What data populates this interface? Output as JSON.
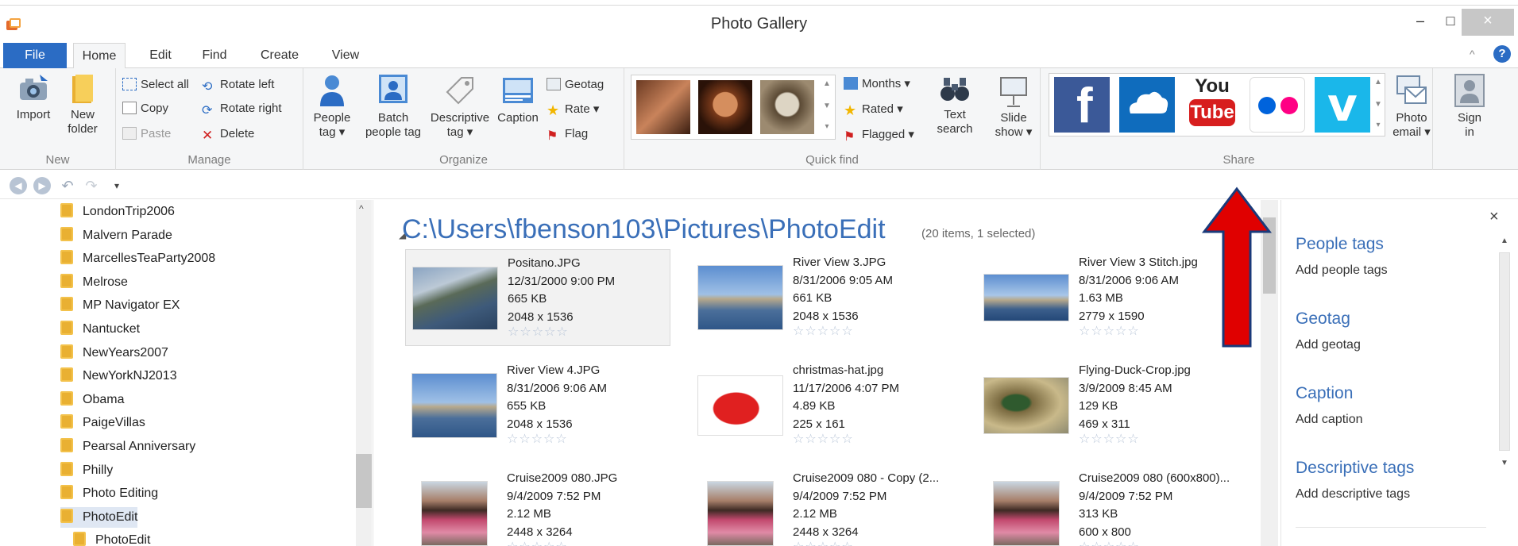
{
  "window": {
    "title": "Photo Gallery",
    "minimize": "–",
    "maximize": "□",
    "close": "×"
  },
  "tabs": [
    "File",
    "Home",
    "Edit",
    "Find",
    "Create",
    "View"
  ],
  "ribbon_controls": {
    "collapse": "^",
    "help": "?"
  },
  "ribbon": {
    "new": {
      "label": "New",
      "import": "Import",
      "new_folder_1": "New",
      "new_folder_2": "folder"
    },
    "manage": {
      "label": "Manage",
      "select_all": "Select all",
      "copy": "Copy",
      "paste": "Paste",
      "rotate_left": "Rotate left",
      "rotate_right": "Rotate right",
      "delete": "Delete"
    },
    "organize": {
      "label": "Organize",
      "people_tag_1": "People",
      "people_tag_2": "tag ▾",
      "batch_1": "Batch",
      "batch_2": "people tag",
      "desc_1": "Descriptive",
      "desc_2": "tag ▾",
      "caption": "Caption",
      "geotag": "Geotag",
      "rate": "Rate ▾",
      "flag": "Flag"
    },
    "quickfind": {
      "label": "Quick find",
      "months": "Months ▾",
      "rated": "Rated ▾",
      "flagged": "Flagged ▾",
      "text_1": "Text",
      "text_2": "search"
    },
    "slideshow": {
      "line1": "Slide",
      "line2": "show ▾"
    },
    "share": {
      "label": "Share",
      "services": [
        "facebook",
        "onedrive",
        "youtube",
        "flickr",
        "vimeo"
      ],
      "youtube_1": "You",
      "youtube_2": "Tube",
      "photo_email_1": "Photo",
      "photo_email_2": "email ▾"
    },
    "signin": {
      "line1": "Sign",
      "line2": "in"
    }
  },
  "tree": {
    "items": [
      "LondonTrip2006",
      "Malvern Parade",
      "MarcellesTeaParty2008",
      "Melrose",
      "MP Navigator EX",
      "Nantucket",
      "NewYears2007",
      "NewYorkNJ2013",
      "Obama",
      "PaigeVillas",
      "Pearsal Anniversary",
      "Philly",
      "Photo Editing",
      "PhotoEdit",
      "PhotoEdit"
    ],
    "selected_index": 13
  },
  "main": {
    "path": "C:\\Users\\fbenson103\\Pictures\\PhotoEdit",
    "count": "(20 items, 1 selected)",
    "photos": [
      {
        "name": "Positano.JPG",
        "date": "12/31/2000 9:00 PM",
        "size": "665 KB",
        "dims": "2048 x 1536",
        "thumb": "coast"
      },
      {
        "name": "River View 3.JPG",
        "date": "8/31/2006 9:05 AM",
        "size": "661 KB",
        "dims": "2048 x 1536",
        "thumb": "river"
      },
      {
        "name": "River View 3 Stitch.jpg",
        "date": "8/31/2006 9:06 AM",
        "size": "1.63 MB",
        "dims": "2779 x 1590",
        "thumb": "river-wide"
      },
      {
        "name": "River View 4.JPG",
        "date": "8/31/2006 9:06 AM",
        "size": "655 KB",
        "dims": "2048 x 1536",
        "thumb": "river"
      },
      {
        "name": "christmas-hat.jpg",
        "date": "11/17/2006 4:07 PM",
        "size": "4.89 KB",
        "dims": "225 x 161",
        "thumb": "hat"
      },
      {
        "name": "Flying-Duck-Crop.jpg",
        "date": "3/9/2009 8:45 AM",
        "size": "129 KB",
        "dims": "469 x 311",
        "thumb": "duck"
      },
      {
        "name": "Cruise2009 080.JPG",
        "date": "9/4/2009 7:52 PM",
        "size": "2.12 MB",
        "dims": "2448 x 3264",
        "thumb": "person"
      },
      {
        "name": "Cruise2009 080 - Copy (2...",
        "date": "9/4/2009 7:52 PM",
        "size": "2.12 MB",
        "dims": "2448 x 3264",
        "thumb": "person"
      },
      {
        "name": "Cruise2009 080 (600x800)...",
        "date": "9/4/2009 7:52 PM",
        "size": "313 KB",
        "dims": "600 x 800",
        "thumb": "person"
      }
    ],
    "selected_index": 0,
    "stars": "☆☆☆☆☆"
  },
  "pane": {
    "close": "×",
    "sections": [
      {
        "title": "People tags",
        "action": "Add people tags"
      },
      {
        "title": "Geotag",
        "action": "Add geotag"
      },
      {
        "title": "Caption",
        "action": "Add caption"
      },
      {
        "title": "Descriptive tags",
        "action": "Add descriptive tags"
      }
    ]
  },
  "colors": {
    "accent": "#2b6cc4",
    "link": "#3a6fb8",
    "arrow": "#e00000",
    "arrow_border": "#1a3a7a"
  }
}
